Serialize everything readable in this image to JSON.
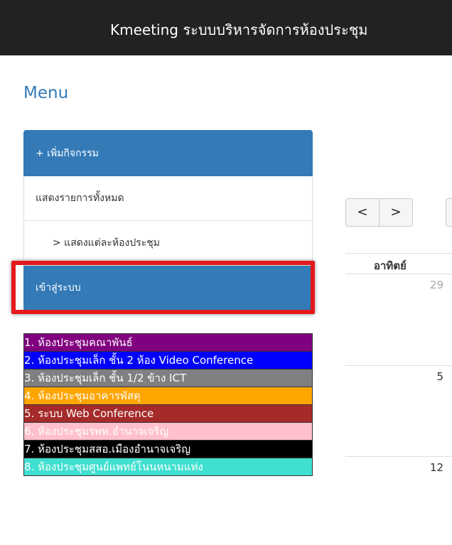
{
  "header": {
    "title": "Kmeeting ระบบบริหารจัดการห้องประชุม"
  },
  "menu": {
    "heading": "Menu",
    "items": [
      {
        "label": "+ เพิ่มกิจกรรม",
        "active": true
      },
      {
        "label": "แสดงรายการทั้งหมด",
        "active": false
      },
      {
        "label": "> แสดงแต่ละห้องประชุม",
        "active": false
      },
      {
        "label": "เข้าสู่ระบบ",
        "active": true
      }
    ]
  },
  "legend": [
    {
      "label": "1. ห้องประชุมคณาพันธ์",
      "bg": "#800080",
      "color": "#ffffff"
    },
    {
      "label": "2. ห้องประชุมเล็ก ชั้น 2 ห้อง Video Conference",
      "bg": "#0000ff",
      "color": "#ffffff"
    },
    {
      "label": "3. ห้องประชุมเล็ก ชั้น 1/2 ข้าง ICT",
      "bg": "#808080",
      "color": "#ffffff"
    },
    {
      "label": "4. ห้องประชุมอาคารพัสดุ",
      "bg": "#ffa500",
      "color": "#ffffff"
    },
    {
      "label": "5. ระบบ Web Conference",
      "bg": "#a52a2a",
      "color": "#ffffff"
    },
    {
      "label": "6. ห้องประชุมรพท.อำนาจเจริญ",
      "bg": "#ffc0cb",
      "color": "#ffffff"
    },
    {
      "label": "7. ห้องประชุมสสอ.เมืองอำนาจเจริญ",
      "bg": "#000000",
      "color": "#ffffff"
    },
    {
      "label": "8. ห้องประชุมศูนย์แพทย์โนนหนามแท่ง",
      "bg": "#40e0d0",
      "color": "#ffffff"
    }
  ],
  "calendar": {
    "nav": {
      "prev": "<",
      "next": ">"
    },
    "day_header": "อาทิตย์",
    "days": [
      {
        "num": "29",
        "muted": true
      },
      {
        "num": "5",
        "muted": false
      },
      {
        "num": "12",
        "muted": false
      }
    ]
  }
}
